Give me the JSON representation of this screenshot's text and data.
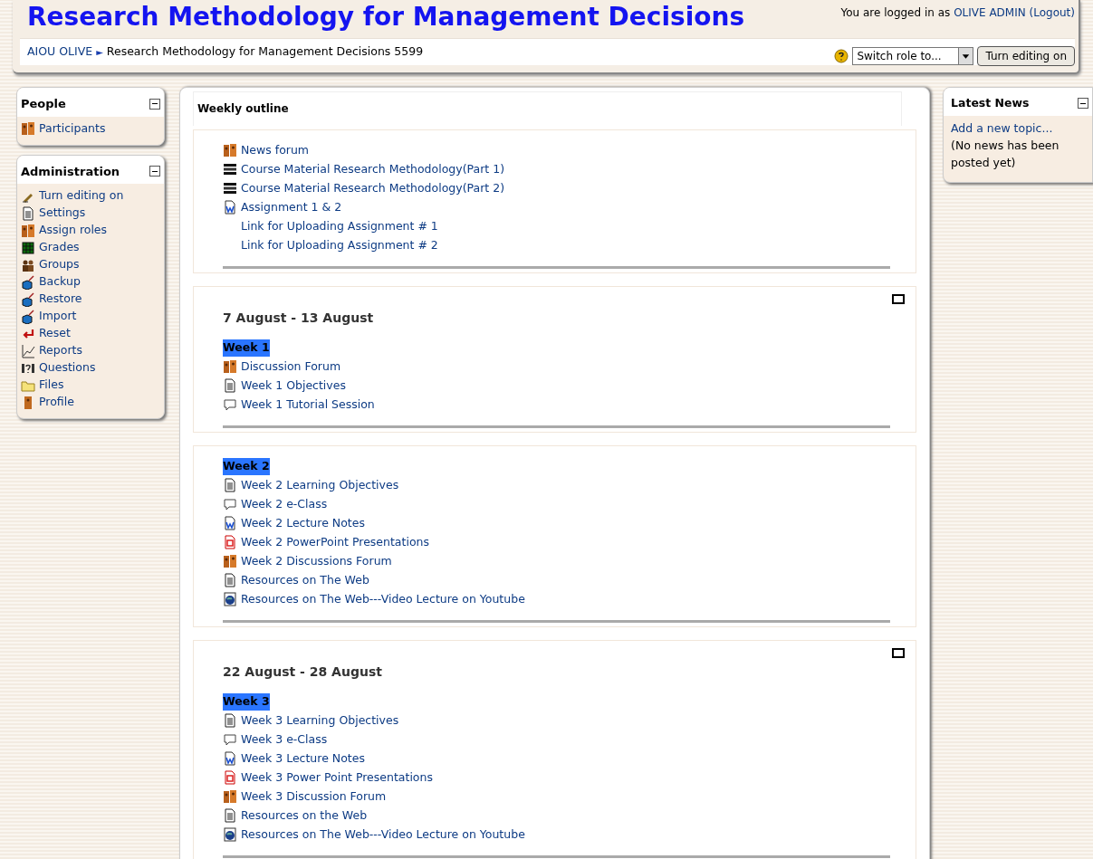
{
  "header": {
    "title": "Research Methodology for Management Decisions",
    "login": {
      "prefix": "You are logged in as",
      "user": "OLIVE ADMIN",
      "logout": "(Logout)"
    },
    "breadcrumb": [
      "AIOU OLIVE",
      "Research Methodology for Management Decisions 5599"
    ],
    "separator": "►",
    "role_select": "Switch role to...",
    "edit_button": "Turn editing on"
  },
  "left_blocks": [
    {
      "title": "People",
      "items": [
        {
          "kind": "people",
          "label": "Participants"
        }
      ]
    },
    {
      "title": "Administration",
      "items": [
        {
          "kind": "pen",
          "label": "Turn editing on"
        },
        {
          "kind": "page",
          "label": "Settings"
        },
        {
          "kind": "people",
          "label": "Assign roles"
        },
        {
          "kind": "grid",
          "label": "Grades"
        },
        {
          "kind": "group",
          "label": "Groups"
        },
        {
          "kind": "box",
          "label": "Backup"
        },
        {
          "kind": "box",
          "label": "Restore"
        },
        {
          "kind": "box",
          "label": "Import"
        },
        {
          "kind": "return",
          "label": "Reset"
        },
        {
          "kind": "chart",
          "label": "Reports"
        },
        {
          "kind": "question",
          "label": "Questions"
        },
        {
          "kind": "folder",
          "label": "Files"
        },
        {
          "kind": "person",
          "label": "Profile"
        }
      ]
    }
  ],
  "outline": {
    "title": "Weekly outline",
    "sections": [
      {
        "items": [
          {
            "kind": "forum",
            "label": "News forum"
          },
          {
            "kind": "book",
            "label": "Course Material Research Methodology(Part 1)"
          },
          {
            "kind": "book",
            "label": "Course Material Research Methodology(Part 2)"
          },
          {
            "kind": "word",
            "label": "Assignment 1 & 2"
          },
          {
            "kind": "none",
            "label": "Link for Uploading Assignment # 1"
          },
          {
            "kind": "none",
            "label": "Link for Uploading Assignment # 2"
          }
        ]
      },
      {
        "date": "7 August - 13 August",
        "week": "Week 1",
        "items": [
          {
            "kind": "forum",
            "label": "Discussion Forum"
          },
          {
            "kind": "page",
            "label": "Week 1 Objectives"
          },
          {
            "kind": "chat",
            "label": "Week 1 Tutorial Session"
          }
        ]
      },
      {
        "week": "Week 2",
        "items": [
          {
            "kind": "page",
            "label": "Week 2 Learning Objectives"
          },
          {
            "kind": "chat",
            "label": "Week 2 e-Class"
          },
          {
            "kind": "word",
            "label": "Week 2 Lecture Notes"
          },
          {
            "kind": "ppt",
            "label": "Week 2 PowerPoint Presentations"
          },
          {
            "kind": "forum",
            "label": "Week 2 Discussions Forum"
          },
          {
            "kind": "page",
            "label": "Resources on The Web"
          },
          {
            "kind": "globe",
            "label": "Resources on The Web---Video Lecture on Youtube"
          }
        ]
      },
      {
        "date": "22 August - 28 August",
        "week": "Week 3",
        "items": [
          {
            "kind": "page",
            "label": "Week 3 Learning Objectives"
          },
          {
            "kind": "chat",
            "label": "Week 3 e-Class"
          },
          {
            "kind": "word",
            "label": "Week 3 Lecture Notes"
          },
          {
            "kind": "ppt",
            "label": "Week 3 Power Point Presentations"
          },
          {
            "kind": "forum",
            "label": "Week 3 Discussion Forum"
          },
          {
            "kind": "page",
            "label": "Resources on the Web"
          },
          {
            "kind": "globe",
            "label": "Resources on The Web---Video Lecture on Youtube"
          }
        ]
      }
    ]
  },
  "right_block": {
    "title": "Latest News",
    "link": "Add a new topic...",
    "text": "(No news has been posted yet)"
  }
}
